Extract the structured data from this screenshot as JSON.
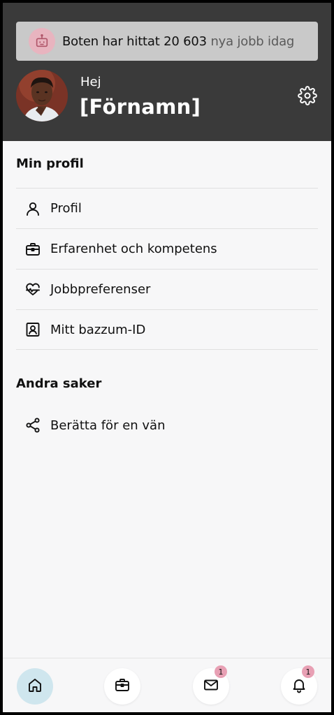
{
  "banner": {
    "lead": "Boten har hittat 20 603",
    "tail": "nya jobb idag",
    "icon": "robot-icon"
  },
  "greeting": {
    "hello": "Hej",
    "name": "[Förnamn]"
  },
  "sections": {
    "profile_title": "Min profil",
    "other_title": "Andra saker"
  },
  "profile_items": [
    {
      "label": "Profil",
      "icon": "user-icon"
    },
    {
      "label": "Erfarenhet och kompetens",
      "icon": "briefcase-icon"
    },
    {
      "label": "Jobbpreferenser",
      "icon": "heart-pulse-icon"
    },
    {
      "label": "Mitt bazzum-ID",
      "icon": "id-badge-icon"
    }
  ],
  "other_items": [
    {
      "label": "Berätta för en vän",
      "icon": "share-icon"
    }
  ],
  "bottom_nav": {
    "messages_badge": "1",
    "notifications_badge": "1",
    "items": [
      "home-icon",
      "briefcase-icon",
      "mail-icon",
      "bell-icon"
    ]
  },
  "colors": {
    "header_bg": "#3a3a3a",
    "banner_bg": "#c9c9c9",
    "bot_bg": "#e8b4bf",
    "badge_bg": "#e8a0b4",
    "active_nav_bg": "#cfe6ee"
  }
}
